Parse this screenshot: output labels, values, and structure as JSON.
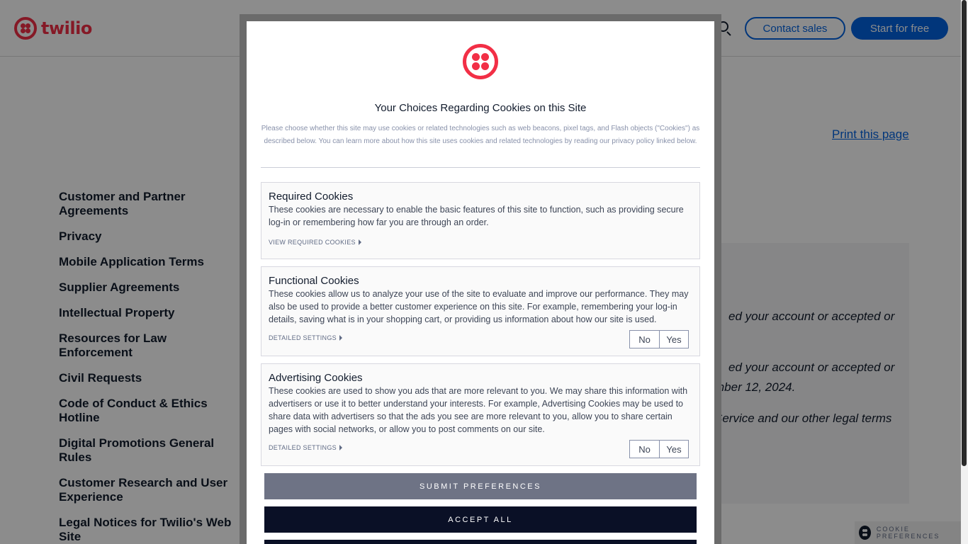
{
  "header": {
    "logo_text": "twilio",
    "contact_sales": "Contact sales",
    "start_free": "Start for free"
  },
  "page": {
    "print_link": "Print this page",
    "nav_items": [
      "Customer and Partner Agreements",
      "Privacy",
      "Mobile Application Terms",
      "Supplier Agreements",
      "Intellectual Property",
      "Resources for Law Enforcement",
      "Civil Requests",
      "Code of Conduct & Ethics Hotline",
      "Digital Promotions General Rules",
      "Customer Research and User Experience",
      "Legal Notices for Twilio's Web Site"
    ],
    "content_fragments": [
      "ed your account or accepted or",
      "ed your account or accepted or",
      "mber 12, 2024.",
      "Service and our other legal terms"
    ]
  },
  "cookie_pref_tab": "COOKIE PREFERENCES",
  "modal": {
    "title": "Your Choices Regarding Cookies on this Site",
    "intro": "Please choose whether this site may use cookies or related technologies such as web beacons, pixel tags, and Flash objects (\"Cookies\") as described below. You can learn more about how this site uses cookies and related technologies by reading our privacy policy linked below.",
    "sections": [
      {
        "title": "Required Cookies",
        "description": "These cookies are necessary to enable the basic features of this site to function, such as providing secure log-in or remembering how far you are through an order.",
        "link": "VIEW REQUIRED COOKIES"
      },
      {
        "title": "Functional Cookies",
        "description": "These cookies allow us to analyze your use of the site to evaluate and improve our performance. They may also be used to provide a better customer experience on this site. For example, remembering your log-in details, saving what is in your shopping cart, or providing us information about how our site is used.",
        "link": "DETAILED SETTINGS",
        "no": "No",
        "yes": "Yes"
      },
      {
        "title": "Advertising Cookies",
        "description": "These cookies are used to show you ads that are more relevant to you. We may share this information with advertisers or use it to better understand your interests. For example, Advertising Cookies may be used to share data with advertisers so that the ads you see are more relevant to you, allow you to share certain pages with social networks, or allow you to post comments on our site.",
        "link": "DETAILED SETTINGS",
        "no": "No",
        "yes": "Yes"
      }
    ],
    "submit": "SUBMIT PREFERENCES",
    "accept_all": "ACCEPT ALL"
  },
  "colors": {
    "brand_red": "#f22f46",
    "link_blue": "#0263e0",
    "dark_navy": "#0a1026"
  }
}
